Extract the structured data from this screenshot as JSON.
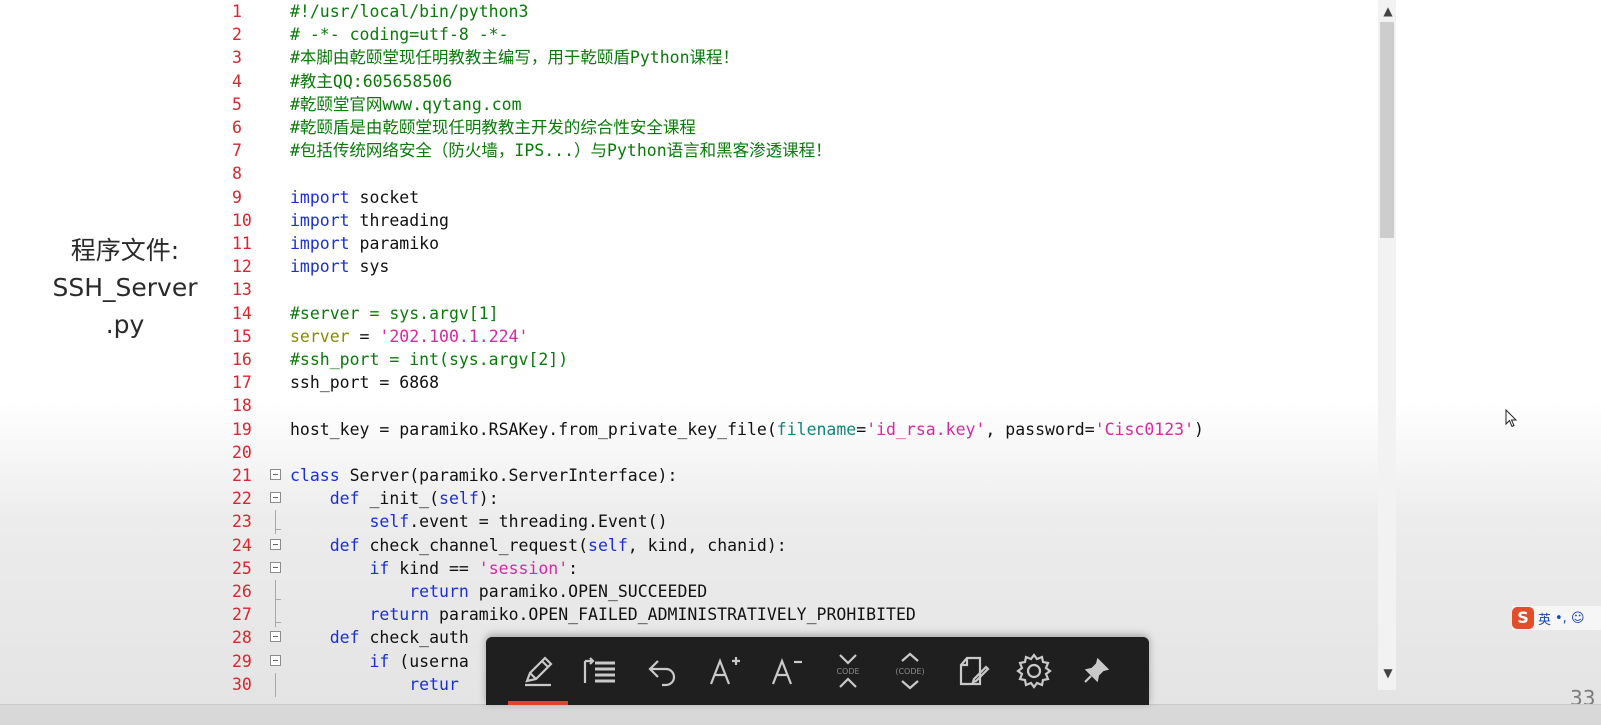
{
  "side_label": {
    "line1": "程序文件:",
    "line2": "SSH_Server",
    "line3": ".py"
  },
  "code": [
    {
      "n": "1",
      "parts": [
        {
          "c": "cmt",
          "t": "#!/usr/local/bin/python3"
        }
      ]
    },
    {
      "n": "2",
      "parts": [
        {
          "c": "cmt",
          "t": "# -*- coding=utf-8 -*-"
        }
      ]
    },
    {
      "n": "3",
      "parts": [
        {
          "c": "cmt",
          "t": "#本脚由乾颐堂现任明教教主编写，用于乾颐盾Python课程！"
        }
      ]
    },
    {
      "n": "4",
      "parts": [
        {
          "c": "cmt",
          "t": "#教主QQ:605658506"
        }
      ]
    },
    {
      "n": "5",
      "parts": [
        {
          "c": "cmt",
          "t": "#乾颐堂官网www.qytang.com"
        }
      ]
    },
    {
      "n": "6",
      "parts": [
        {
          "c": "cmt",
          "t": "#乾颐盾是由乾颐堂现任明教教主开发的综合性安全课程"
        }
      ]
    },
    {
      "n": "7",
      "parts": [
        {
          "c": "cmt",
          "t": "#包括传统网络安全（防火墙，IPS...）与Python语言和黑客渗透课程！"
        }
      ]
    },
    {
      "n": "8",
      "parts": []
    },
    {
      "n": "9",
      "parts": [
        {
          "c": "kw",
          "t": "import"
        },
        {
          "c": "",
          "t": " socket"
        }
      ]
    },
    {
      "n": "10",
      "parts": [
        {
          "c": "kw",
          "t": "import"
        },
        {
          "c": "",
          "t": " threading"
        }
      ]
    },
    {
      "n": "11",
      "parts": [
        {
          "c": "kw",
          "t": "import"
        },
        {
          "c": "",
          "t": " paramiko"
        }
      ]
    },
    {
      "n": "12",
      "parts": [
        {
          "c": "kw",
          "t": "import"
        },
        {
          "c": "",
          "t": " sys"
        }
      ]
    },
    {
      "n": "13",
      "parts": []
    },
    {
      "n": "14",
      "parts": [
        {
          "c": "cmt",
          "t": "#server = sys.argv[1]"
        }
      ]
    },
    {
      "n": "15",
      "parts": [
        {
          "c": "var",
          "t": "server"
        },
        {
          "c": "",
          "t": " = "
        },
        {
          "c": "str",
          "t": "'202.100.1.224'"
        }
      ]
    },
    {
      "n": "16",
      "parts": [
        {
          "c": "cmt",
          "t": "#ssh_port = int(sys.argv[2])"
        }
      ]
    },
    {
      "n": "17",
      "parts": [
        {
          "c": "",
          "t": "ssh_port = 6868"
        }
      ]
    },
    {
      "n": "18",
      "parts": []
    },
    {
      "n": "19",
      "parts": [
        {
          "c": "",
          "t": "host_key = paramiko.RSAKey.from_private_key_file("
        },
        {
          "c": "prm",
          "t": "filename"
        },
        {
          "c": "",
          "t": "="
        },
        {
          "c": "str",
          "t": "'id_rsa.key'"
        },
        {
          "c": "",
          "t": ", password="
        },
        {
          "c": "str",
          "t": "'Cisc0123'"
        },
        {
          "c": "",
          "t": ")"
        }
      ]
    },
    {
      "n": "20",
      "parts": []
    },
    {
      "n": "21",
      "fold": "box",
      "parts": [
        {
          "c": "kw",
          "t": "class"
        },
        {
          "c": "",
          "t": " Server(paramiko.ServerInterface):"
        }
      ]
    },
    {
      "n": "22",
      "fold": "box",
      "parts": [
        {
          "c": "",
          "t": "    "
        },
        {
          "c": "kw",
          "t": "def"
        },
        {
          "c": "",
          "t": " _init_("
        },
        {
          "c": "slf",
          "t": "self"
        },
        {
          "c": "",
          "t": "):"
        }
      ]
    },
    {
      "n": "23",
      "fold": "end",
      "parts": [
        {
          "c": "",
          "t": "        "
        },
        {
          "c": "slf",
          "t": "self"
        },
        {
          "c": "",
          "t": ".event = threading.Event()"
        }
      ]
    },
    {
      "n": "24",
      "fold": "box",
      "parts": [
        {
          "c": "",
          "t": "    "
        },
        {
          "c": "kw",
          "t": "def"
        },
        {
          "c": "",
          "t": " check_channel_request("
        },
        {
          "c": "slf",
          "t": "self"
        },
        {
          "c": "",
          "t": ", kind, chanid):"
        }
      ]
    },
    {
      "n": "25",
      "fold": "box",
      "parts": [
        {
          "c": "",
          "t": "        "
        },
        {
          "c": "kw",
          "t": "if"
        },
        {
          "c": "",
          "t": " kind == "
        },
        {
          "c": "str",
          "t": "'session'"
        },
        {
          "c": "",
          "t": ":"
        }
      ]
    },
    {
      "n": "26",
      "fold": "end",
      "parts": [
        {
          "c": "",
          "t": "            "
        },
        {
          "c": "kw",
          "t": "return"
        },
        {
          "c": "",
          "t": " paramiko.OPEN_SUCCEEDED"
        }
      ]
    },
    {
      "n": "27",
      "fold": "end",
      "parts": [
        {
          "c": "",
          "t": "        "
        },
        {
          "c": "kw",
          "t": "return"
        },
        {
          "c": "",
          "t": " paramiko.OPEN_FAILED_ADMINISTRATIVELY_PROHIBITED"
        }
      ]
    },
    {
      "n": "28",
      "fold": "box",
      "parts": [
        {
          "c": "",
          "t": "    "
        },
        {
          "c": "kw",
          "t": "def"
        },
        {
          "c": "",
          "t": " check_auth"
        }
      ]
    },
    {
      "n": "29",
      "fold": "box",
      "parts": [
        {
          "c": "",
          "t": "        "
        },
        {
          "c": "kw",
          "t": "if"
        },
        {
          "c": "",
          "t": " (userna"
        }
      ]
    },
    {
      "n": "30",
      "fold": "line",
      "parts": [
        {
          "c": "",
          "t": "            "
        },
        {
          "c": "kw",
          "t": "retur"
        }
      ]
    }
  ],
  "ime": {
    "logo": "S",
    "lang": "英",
    "extra": "•, ☺"
  },
  "page_number": "33",
  "toolbar": [
    {
      "name": "pen-icon",
      "label": "pen"
    },
    {
      "name": "outline-icon",
      "label": "outline"
    },
    {
      "name": "undo-icon",
      "label": "undo"
    },
    {
      "name": "font-increase-icon",
      "label": "A+"
    },
    {
      "name": "font-decrease-icon",
      "label": "A-"
    },
    {
      "name": "collapse-code-icon",
      "label": "CODE"
    },
    {
      "name": "expand-code-icon",
      "label": "(CODE)"
    },
    {
      "name": "copy-edit-icon",
      "label": "copy"
    },
    {
      "name": "settings-icon",
      "label": "settings"
    },
    {
      "name": "pin-icon",
      "label": "pin"
    }
  ],
  "colors": {
    "line_number": "#d9262e",
    "keyword": "#1a2fd6",
    "string": "#d62aa3",
    "comment": "#0a7a0a",
    "toolbar_bg": "#1f1f1f",
    "active_accent": "#e0442b"
  }
}
